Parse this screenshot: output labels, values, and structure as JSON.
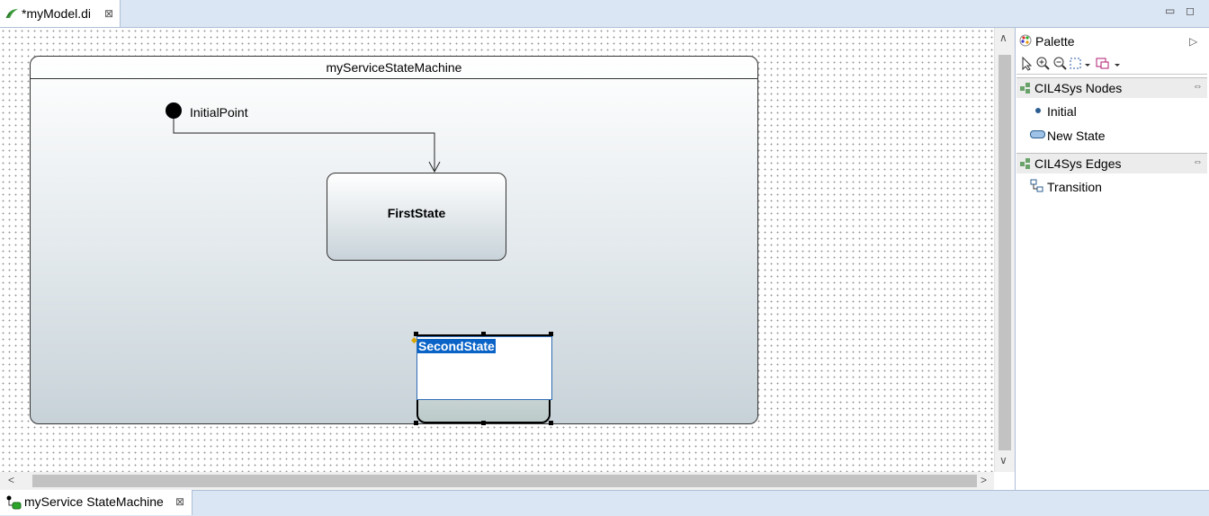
{
  "editor_tab": {
    "title": "*myModel.di",
    "close": "⊠"
  },
  "window_controls": {
    "minimize": "▭",
    "maximize": "◻"
  },
  "diagram": {
    "state_machine_title": "myServiceStateMachine",
    "initial_label": "InitialPoint",
    "first_state": "FirstState",
    "second_state": "SecondState"
  },
  "palette": {
    "title": "Palette",
    "sections": [
      {
        "title": "CIL4Sys Nodes",
        "items": [
          "Initial",
          "New State"
        ]
      },
      {
        "title": "CIL4Sys Edges",
        "items": [
          "Transition"
        ]
      }
    ]
  },
  "scroll": {
    "up": "∧",
    "down": "∨",
    "left": "<",
    "right": ">"
  },
  "bottom_tab": {
    "title": "myService StateMachine",
    "close": "⊠"
  }
}
